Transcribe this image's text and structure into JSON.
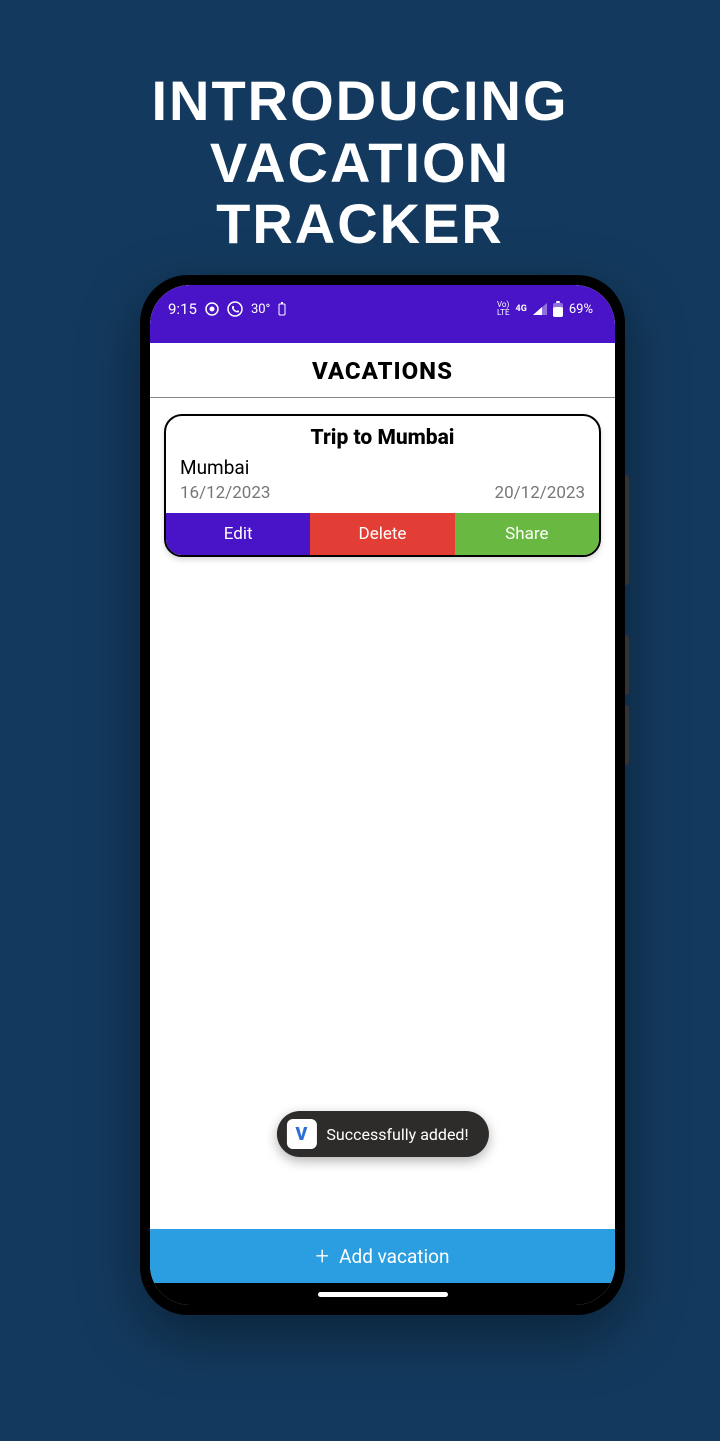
{
  "promo": {
    "title_line1": "Introducing Vacation",
    "title_line2": "Tracker"
  },
  "status_bar": {
    "time": "9:15",
    "battery_pct_text": "69%",
    "temp_text": "30°",
    "network_text": "4G",
    "lte_text": "LTE",
    "vo_text": "Vo"
  },
  "page": {
    "title": "VACATIONS"
  },
  "vacation_card": {
    "title": "Trip to Mumbai",
    "location": "Mumbai",
    "start_date": "16/12/2023",
    "end_date": "20/12/2023",
    "actions": {
      "edit": "Edit",
      "delete": "Delete",
      "share": "Share"
    }
  },
  "toast": {
    "icon_letter": "V",
    "message": "Successfully added!"
  },
  "bottom_button": {
    "label": "Add vacation"
  }
}
